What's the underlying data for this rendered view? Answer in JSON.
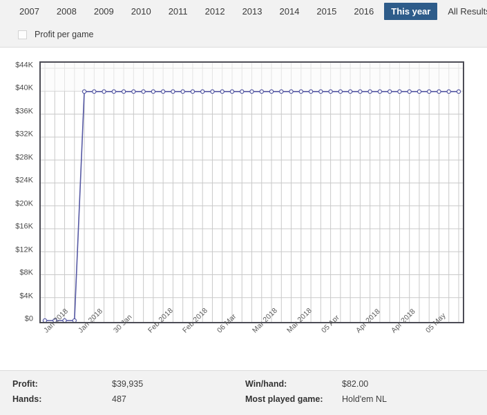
{
  "tabs": [
    {
      "label": "2007",
      "active": false
    },
    {
      "label": "2008",
      "active": false
    },
    {
      "label": "2009",
      "active": false
    },
    {
      "label": "2010",
      "active": false
    },
    {
      "label": "2011",
      "active": false
    },
    {
      "label": "2012",
      "active": false
    },
    {
      "label": "2013",
      "active": false
    },
    {
      "label": "2014",
      "active": false
    },
    {
      "label": "2015",
      "active": false
    },
    {
      "label": "2016",
      "active": false
    },
    {
      "label": "This year",
      "active": true
    },
    {
      "label": "All Results",
      "active": false
    }
  ],
  "options": {
    "profit_per_game_label": "Profit per game",
    "profit_per_game_checked": false
  },
  "colors": {
    "active_tab": "#2e5c8a",
    "series_line": "#5558a3",
    "marker_fill": "#ffffff",
    "plot_border": "#4c4c55",
    "grid": "#c9c9c9",
    "panel_bg": "#f2f2f2"
  },
  "footer": {
    "rows": [
      {
        "key": "Profit:",
        "value": "$39,935",
        "key2": "Win/hand:",
        "value2": "$82.00"
      },
      {
        "key": "Hands:",
        "value": "487",
        "key2": "Most played game:",
        "value2": "Hold'em NL"
      }
    ]
  },
  "chart_data": {
    "type": "line",
    "title": "",
    "xlabel": "",
    "ylabel": "",
    "ylim": [
      0,
      44000
    ],
    "ytick_labels": [
      "$0",
      "$4K",
      "$8K",
      "$12K",
      "$16K",
      "$20K",
      "$24K",
      "$28K",
      "$32K",
      "$36K",
      "$40K",
      "$44K"
    ],
    "ytick_values": [
      0,
      4000,
      8000,
      12000,
      16000,
      20000,
      24000,
      28000,
      32000,
      36000,
      40000,
      44000
    ],
    "grid": true,
    "legend": "none",
    "xtick_labels": [
      "Jan 2018",
      "Jan 2018",
      "30 Jan",
      "Feb 2018",
      "Feb 2018",
      "06 Mar",
      "Mar 2018",
      "Mar 2018",
      "05 Apr",
      "Apr 2018",
      "Apr 2018",
      "05 May"
    ],
    "xtick_indices": [
      0,
      3.5,
      7,
      10.5,
      14,
      17.5,
      21,
      24.5,
      28,
      31.5,
      35,
      38.5
    ],
    "series": [
      {
        "name": "Profit",
        "values": [
          0,
          0,
          0,
          0,
          39935,
          39935,
          39935,
          39935,
          39935,
          39935,
          39935,
          39935,
          39935,
          39935,
          39935,
          39935,
          39935,
          39935,
          39935,
          39935,
          39935,
          39935,
          39935,
          39935,
          39935,
          39935,
          39935,
          39935,
          39935,
          39935,
          39935,
          39935,
          39935,
          39935,
          39935,
          39935,
          39935,
          39935,
          39935,
          39935,
          39935,
          39935,
          39935
        ]
      }
    ]
  }
}
